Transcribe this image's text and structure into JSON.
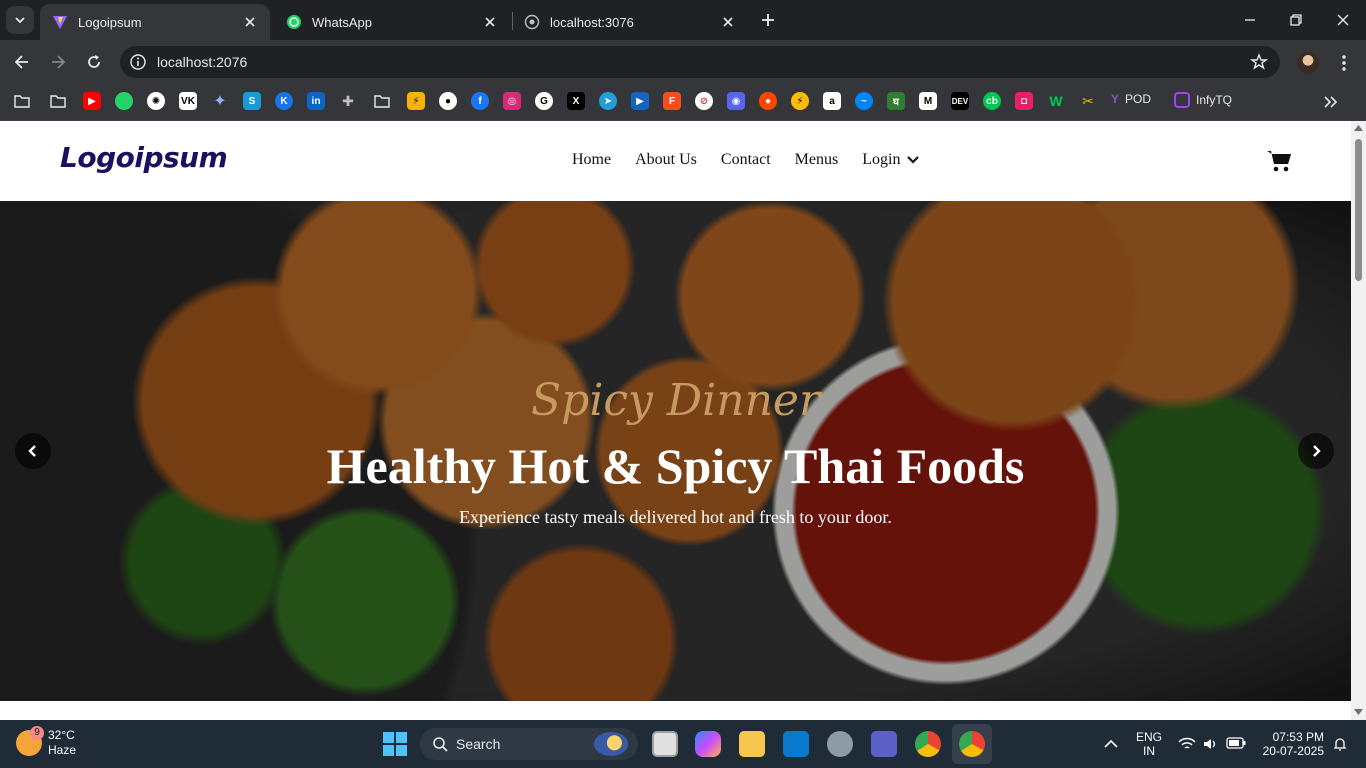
{
  "browser": {
    "tabs": [
      {
        "title": "Logoipsum",
        "active": true
      },
      {
        "title": "WhatsApp",
        "active": false
      },
      {
        "title": "localhost:3076",
        "active": false
      }
    ],
    "url": "localhost:2076",
    "bookmarks_text": [
      "POD",
      "InfyTQ"
    ]
  },
  "site": {
    "logo": "Logoipsum",
    "nav": {
      "home": "Home",
      "about": "About Us",
      "contact": "Contact",
      "menus": "Menus",
      "login": "Login"
    }
  },
  "hero": {
    "subtitle": "Spicy Dinner",
    "title": "Healthy Hot & Spicy Thai Foods",
    "description": "Experience tasty meals delivered hot and fresh to your door."
  },
  "taskbar": {
    "temperature": "32°C",
    "weather": "Haze",
    "notification_count": "9",
    "search": "Search",
    "lang_top": "ENG",
    "lang_bottom": "IN",
    "time": "07:53 PM",
    "date": "20-07-2025"
  },
  "colors": {
    "brand": "#1c1060",
    "hero_accent": "#c79a62",
    "browser_dark": "#202124",
    "taskbar": "#1f2b36"
  }
}
